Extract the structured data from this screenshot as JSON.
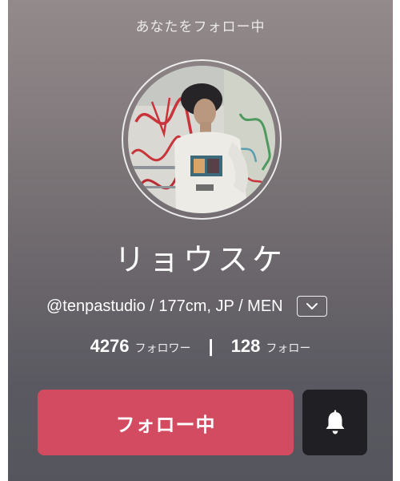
{
  "profile": {
    "follows_you_label": "あなたをフォロー中",
    "avatar_alt": "profile photo",
    "display_name": "リョウスケ",
    "meta_line": "@tenpastudio / 177cm, JP / MEN",
    "expand_icon": "chevron-down-icon"
  },
  "stats": {
    "followers_count": "4276",
    "followers_label": "フォロワー",
    "separator": "|",
    "following_count": "128",
    "following_label": "フォロー"
  },
  "actions": {
    "follow_button_label": "フォロー中",
    "follow_button_color": "#d34b61",
    "notification_icon": "bell-icon",
    "notification_button_color": "#1f1f24"
  },
  "colors": {
    "background_top": "#938a8b",
    "background_bottom": "#55565d",
    "text": "#ffffff"
  }
}
